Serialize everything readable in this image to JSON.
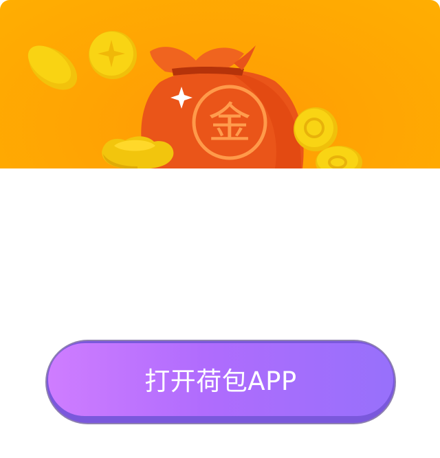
{
  "banner": {
    "coin_glyph": "金",
    "icons": [
      "money-bag-icon",
      "gold-coin-icon",
      "gold-ingot-icon",
      "sparkle-icon"
    ]
  },
  "actions": {
    "open_app_label": "打开荷包APP"
  },
  "colors": {
    "banner_bg": "#ffa403",
    "bag": "#ee5a1a",
    "coin": "#f5cf10",
    "button_start": "#cf7dff",
    "button_end": "#9770fb",
    "button_text": "#ffffff"
  }
}
